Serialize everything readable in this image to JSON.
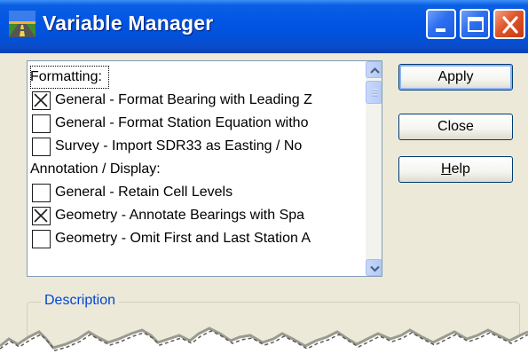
{
  "window": {
    "title": "Variable Manager",
    "controls": {
      "minimize": "minimize",
      "maximize": "maximize",
      "close": "close"
    }
  },
  "list": {
    "rows": [
      {
        "kind": "header",
        "label": "Formatting:",
        "focused": true
      },
      {
        "kind": "item",
        "label": "General - Format Bearing with Leading Z",
        "checked": true
      },
      {
        "kind": "item",
        "label": "General - Format Station Equation witho",
        "checked": false
      },
      {
        "kind": "item",
        "label": "Survey - Import SDR33 as Easting / No",
        "checked": false
      },
      {
        "kind": "header",
        "label": "Annotation / Display:",
        "focused": false
      },
      {
        "kind": "item",
        "label": "General - Retain Cell Levels",
        "checked": false
      },
      {
        "kind": "item",
        "label": "Geometry - Annotate Bearings with Spa",
        "checked": true
      },
      {
        "kind": "item",
        "label": "Geometry - Omit First and Last Station A",
        "checked": false
      }
    ]
  },
  "buttons": {
    "apply": "Apply",
    "close": "Close",
    "help_prefix": "",
    "help_mnemonic": "H",
    "help_rest": "elp"
  },
  "description": {
    "label": "Description"
  },
  "colors": {
    "titlebar": "#0054e3",
    "dialog_bg": "#ece9d8",
    "group_label": "#0046d5",
    "button_border": "#003c74"
  }
}
